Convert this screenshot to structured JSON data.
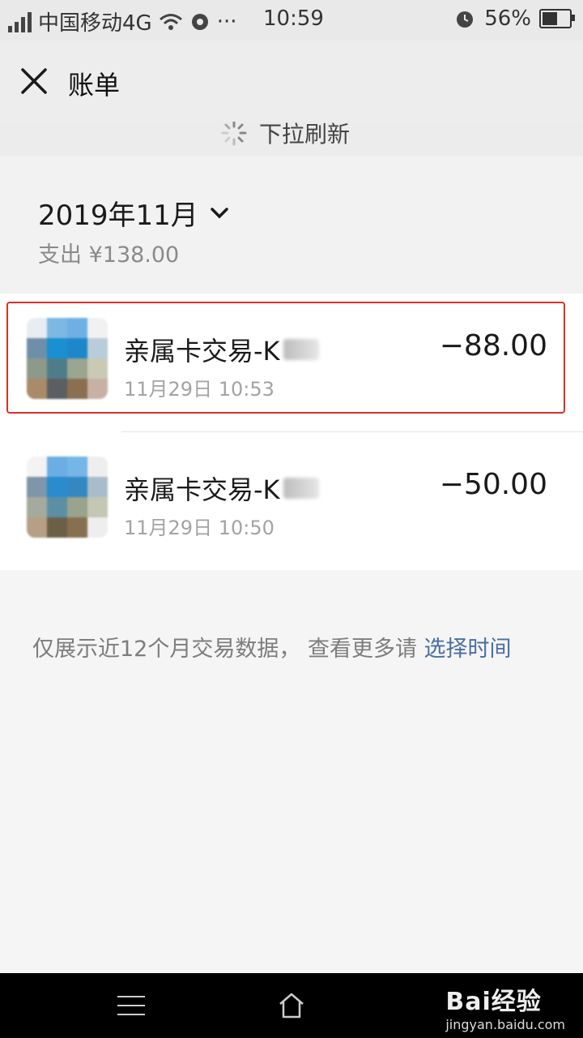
{
  "status_bar": {
    "carrier": "中国移动4G",
    "time": "10:59",
    "battery": "56%",
    "battery_level": 0.56
  },
  "header": {
    "title": "账单"
  },
  "refresh": {
    "text": "下拉刷新"
  },
  "month": {
    "label": "2019年11月",
    "expense": "支出 ¥138.00"
  },
  "transactions": [
    {
      "title": "亲属卡交易-K",
      "time": "11月29日 10:53",
      "amount": "−88.00"
    },
    {
      "title": "亲属卡交易-K",
      "time": "11月29日 10:50",
      "amount": "−50.00"
    }
  ],
  "footer_note": {
    "text": "仅展示近12个月交易数据， 查看更多请 ",
    "link": "选择时间"
  },
  "watermark": {
    "logo": "Bai经验",
    "url": "jingyan.baidu.com"
  },
  "colors": {
    "highlight_border": "#d9302a",
    "link": "#4a6fa0"
  }
}
